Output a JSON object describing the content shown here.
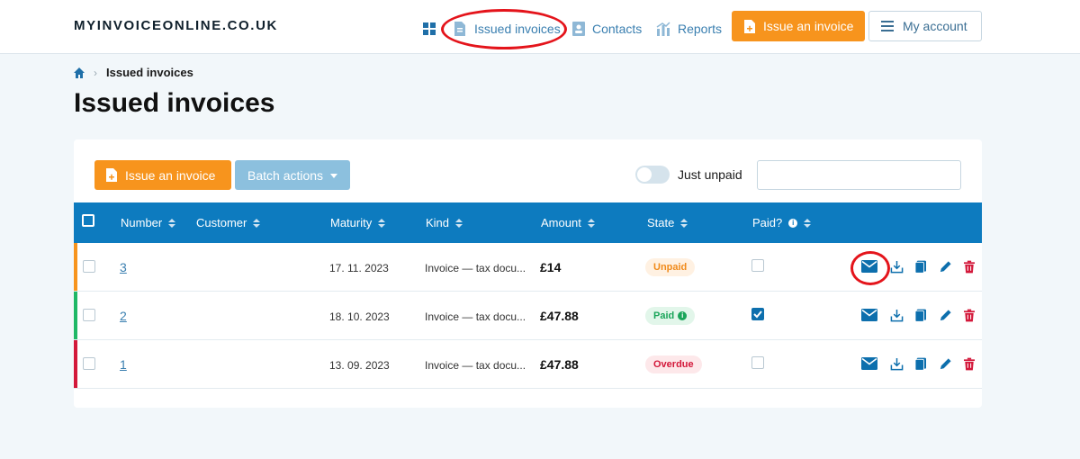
{
  "brand": {
    "logo_text": "MYINVOICEONLINE.CO.UK"
  },
  "nav": {
    "issued_label": "Issued invoices",
    "contacts_label": "Contacts",
    "reports_label": "Reports",
    "issue_button": "Issue an invoice",
    "account_button": "My account"
  },
  "breadcrumb": {
    "current": "Issued invoices"
  },
  "page": {
    "title": "Issued invoices"
  },
  "toolbar": {
    "issue_button": "Issue an invoice",
    "batch_button": "Batch actions",
    "toggle_label": "Just unpaid",
    "toggle_on": false,
    "search_value": ""
  },
  "table": {
    "columns": [
      "Number",
      "Customer",
      "Maturity",
      "Kind",
      "Amount",
      "State",
      "Paid?"
    ],
    "rows": [
      {
        "number": "3",
        "customer": "",
        "maturity": "17. 11. 2023",
        "kind": "Invoice — tax docu...",
        "amount": "£14",
        "state": "Unpaid",
        "paid": false,
        "stripe_color": "#f7941d"
      },
      {
        "number": "2",
        "customer": "",
        "maturity": "18. 10. 2023",
        "kind": "Invoice — tax docu...",
        "amount": "£47.88",
        "state": "Paid",
        "paid": true,
        "stripe_color": "#1fb866"
      },
      {
        "number": "1",
        "customer": "",
        "maturity": "13. 09. 2023",
        "kind": "Invoice — tax docu...",
        "amount": "£47.88",
        "state": "Overdue",
        "paid": false,
        "stripe_color": "#d3183a"
      }
    ],
    "row_actions": [
      "mail-icon",
      "download-icon",
      "copy-icon",
      "edit-icon",
      "delete-icon"
    ]
  },
  "colors": {
    "accent": "#f7941d",
    "primary": "#0d7bbf",
    "annotation": "#e4141b"
  }
}
